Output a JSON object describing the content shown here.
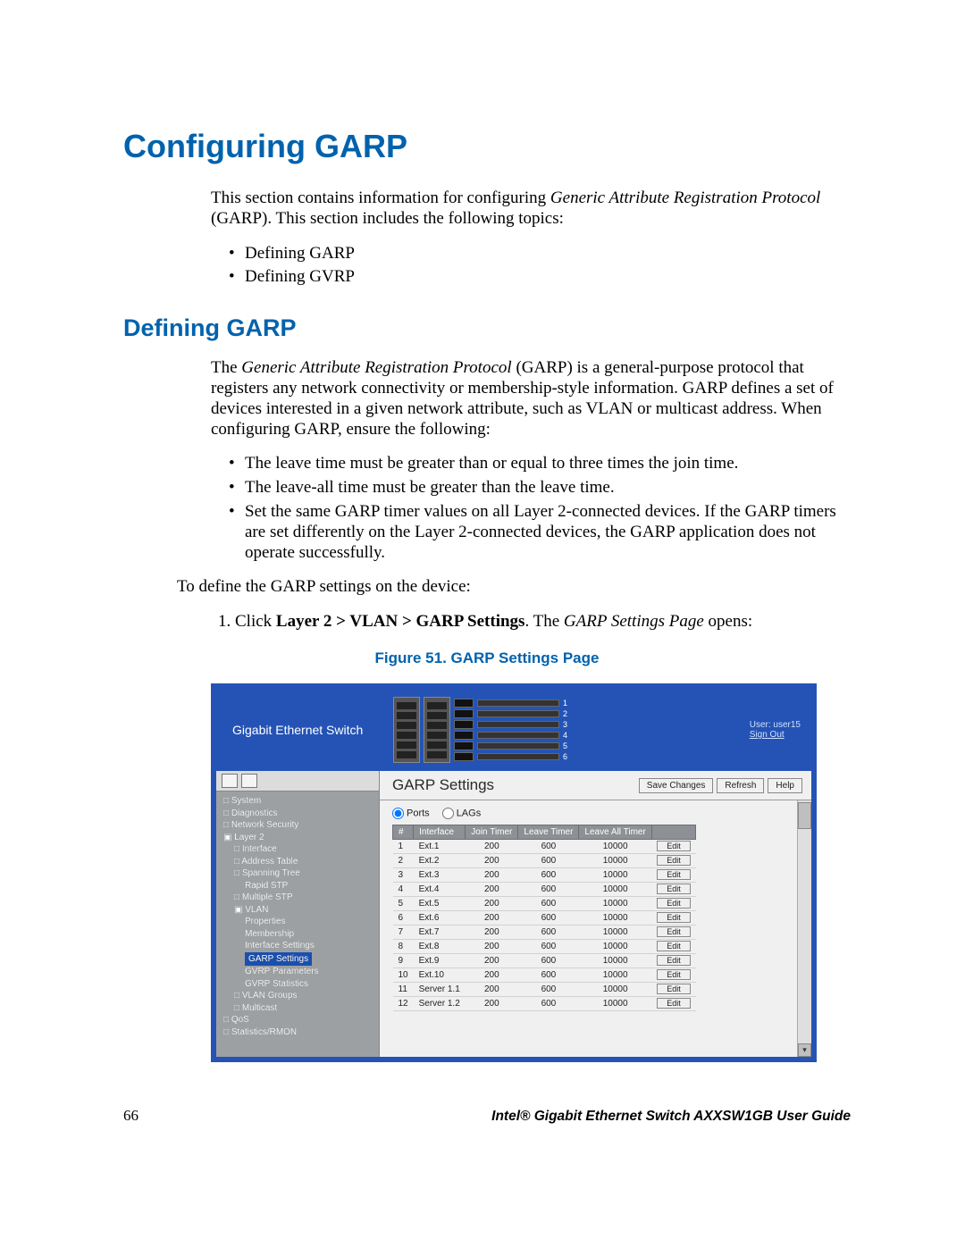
{
  "h1": "Configuring GARP",
  "intro_a": "This section contains information for configuring ",
  "intro_b_italic": "Generic Attribute Registration Protocol",
  "intro_c": " (GARP). This section includes the following topics:",
  "intro_bullets": [
    "Defining GARP",
    "Defining GVRP"
  ],
  "h2": "Defining GARP",
  "para2_a": "The ",
  "para2_b_italic": "Generic Attribute Registration Protocol",
  "para2_c": " (GARP) is a general-purpose protocol that registers any network connectivity or membership-style information. GARP defines a set of devices interested in a given network attribute, such as VLAN or multicast address. When configuring GARP, ensure the following:",
  "rules": [
    "The leave time must be greater than or equal to three times the join time.",
    "The leave-all time must be greater than the leave time.",
    "Set the same GARP timer values on all Layer 2-connected devices. If the GARP timers are set differently on the Layer 2-connected devices, the GARP application does not operate successfully."
  ],
  "para3": "To define the GARP settings on the device:",
  "step1_a": "Click ",
  "step1_b_bold": "Layer 2 > VLAN > GARP Settings",
  "step1_c": ". The ",
  "step1_d_italic": "GARP Settings Page",
  "step1_e": " opens:",
  "figcap": "Figure 51. GARP Settings Page",
  "shot": {
    "product": "Gigabit Ethernet Switch",
    "user_label": "User: user15",
    "signout": "Sign Out",
    "nav": {
      "items": [
        {
          "t": "System",
          "lv": 0,
          "ic": "□"
        },
        {
          "t": "Diagnostics",
          "lv": 0,
          "ic": "□"
        },
        {
          "t": "Network Security",
          "lv": 0,
          "ic": "□"
        },
        {
          "t": "Layer 2",
          "lv": 0,
          "ic": "▣"
        },
        {
          "t": "Interface",
          "lv": 1,
          "ic": "□"
        },
        {
          "t": "Address Table",
          "lv": 1,
          "ic": "□"
        },
        {
          "t": "Spanning Tree",
          "lv": 1,
          "ic": "□"
        },
        {
          "t": "Rapid STP",
          "lv": 2,
          "ic": ""
        },
        {
          "t": "Multiple STP",
          "lv": 1,
          "ic": "□"
        },
        {
          "t": "VLAN",
          "lv": 1,
          "ic": "▣"
        },
        {
          "t": "Properties",
          "lv": 2,
          "ic": ""
        },
        {
          "t": "Membership",
          "lv": 2,
          "ic": ""
        },
        {
          "t": "Interface Settings",
          "lv": 2,
          "ic": ""
        },
        {
          "t": "GARP Settings",
          "lv": 2,
          "ic": "",
          "sel": true
        },
        {
          "t": "GVRP Parameters",
          "lv": 2,
          "ic": ""
        },
        {
          "t": "GVRP Statistics",
          "lv": 2,
          "ic": ""
        },
        {
          "t": "VLAN Groups",
          "lv": 1,
          "ic": "□"
        },
        {
          "t": "Multicast",
          "lv": 1,
          "ic": "□"
        },
        {
          "t": "QoS",
          "lv": 0,
          "ic": "□"
        },
        {
          "t": "Statistics/RMON",
          "lv": 0,
          "ic": "□"
        }
      ]
    },
    "content": {
      "title": "GARP Settings",
      "buttons": {
        "save": "Save Changes",
        "refresh": "Refresh",
        "help": "Help"
      },
      "radios": {
        "ports": "Ports",
        "lags": "LAGs"
      },
      "headers": [
        "#",
        "Interface",
        "Join Timer",
        "Leave Timer",
        "Leave All Timer",
        ""
      ],
      "edit": "Edit",
      "rows": [
        {
          "n": 1,
          "if": "Ext.1",
          "j": 200,
          "l": 600,
          "la": 10000
        },
        {
          "n": 2,
          "if": "Ext.2",
          "j": 200,
          "l": 600,
          "la": 10000
        },
        {
          "n": 3,
          "if": "Ext.3",
          "j": 200,
          "l": 600,
          "la": 10000
        },
        {
          "n": 4,
          "if": "Ext.4",
          "j": 200,
          "l": 600,
          "la": 10000
        },
        {
          "n": 5,
          "if": "Ext.5",
          "j": 200,
          "l": 600,
          "la": 10000
        },
        {
          "n": 6,
          "if": "Ext.6",
          "j": 200,
          "l": 600,
          "la": 10000
        },
        {
          "n": 7,
          "if": "Ext.7",
          "j": 200,
          "l": 600,
          "la": 10000
        },
        {
          "n": 8,
          "if": "Ext.8",
          "j": 200,
          "l": 600,
          "la": 10000
        },
        {
          "n": 9,
          "if": "Ext.9",
          "j": 200,
          "l": 600,
          "la": 10000
        },
        {
          "n": 10,
          "if": "Ext.10",
          "j": 200,
          "l": 600,
          "la": 10000
        },
        {
          "n": 11,
          "if": "Server 1.1",
          "j": 200,
          "l": 600,
          "la": 10000
        },
        {
          "n": 12,
          "if": "Server 1.2",
          "j": 200,
          "l": 600,
          "la": 10000
        }
      ]
    }
  },
  "footer": {
    "page": "66",
    "doc": "Intel® Gigabit Ethernet Switch AXXSW1GB User Guide"
  }
}
